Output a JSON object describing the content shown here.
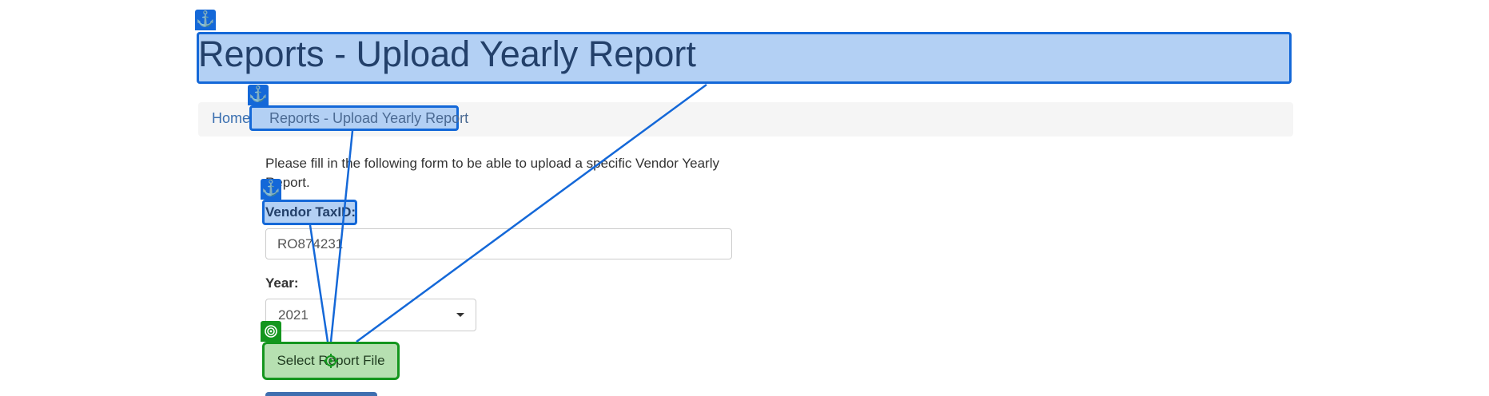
{
  "header": {
    "title": "Reports - Upload Yearly Report"
  },
  "breadcrumb": {
    "home": "Home",
    "separator": "/",
    "current": "Reports - Upload Yearly Report"
  },
  "form": {
    "intro": "Please fill in the following form to be able to upload a specific Vendor Yearly Report.",
    "vendor_label": "Vendor TaxID:",
    "vendor_value": "RO874231",
    "year_label": "Year:",
    "year_value": "2021",
    "file_button": "Select Report File"
  },
  "icons": {
    "anchor": "anchor-icon",
    "target": "target-icon",
    "caret": "caret-down-icon"
  },
  "colors": {
    "highlight_blue": "#1468d8",
    "highlight_blue_fill": "#b3d0f4",
    "highlight_green": "#14961e",
    "highlight_green_fill": "#b6e0b1",
    "link": "#3a6fb0"
  }
}
